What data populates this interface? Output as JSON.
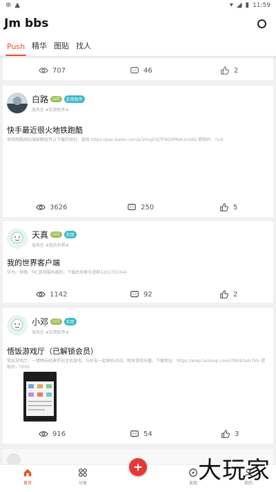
{
  "status_bar": {
    "time": "11:59",
    "left_icons": [
      "app-notification-icon",
      "a-letter-icon"
    ],
    "right_icons": [
      "wifi-icon",
      "signal-icon",
      "battery-icon"
    ]
  },
  "app": {
    "title": "Jm bbs",
    "accent_color": "#e4502a"
  },
  "tabs": [
    {
      "label": "Push",
      "active": true
    },
    {
      "label": "精华",
      "active": false
    },
    {
      "label": "图贴",
      "active": false
    },
    {
      "label": "找人",
      "active": false
    }
  ],
  "feed": {
    "partial_top": {
      "views": "707",
      "comments": "46",
      "likes": "2"
    },
    "posts": [
      {
        "user": "白路",
        "level": "LV2",
        "role": "实用软件",
        "sub": "发布在 #实用软件#",
        "title": "快手最近很火地铁跑酷",
        "body": "地铁跑酷国际服破解版可以下载的地址：链接 https://pan.baidu.com/s/1HvgDSJTFNDSPRNLm3dQ 提取码：7uiil",
        "views": "3626",
        "comments": "250",
        "likes": "5"
      },
      {
        "user": "天真",
        "level": "LV2",
        "role": "实用",
        "sub": "发布在 #我的世界#",
        "title": "我的世界客户端",
        "body": "华为、奔腾、MC游戏服务器的，下载后有群号进群1201703344",
        "views": "1142",
        "comments": "92",
        "likes": "2"
      },
      {
        "user": "小邓",
        "level": "LV2",
        "role": "实用",
        "sub": "发布在 #实用软件#",
        "title": "悟饭游戏厅（已解锁会员）",
        "body": "悟饭游戏厅，一键畅玩经典怀旧主机游戏，与好友一起联机对战，畅享游戏乐趣。下载地址：https://wwp.lanzoup.com/i7BUk0aln7Mv 提取码：hhhh",
        "views": "916",
        "comments": "54",
        "likes": "3"
      }
    ]
  },
  "bottom_nav": {
    "items": [
      {
        "label": "首页",
        "active": true
      },
      {
        "label": "分类",
        "active": false
      },
      {
        "label": "发现",
        "active": false
      },
      {
        "label": "我的",
        "active": false
      }
    ]
  },
  "watermark": "大玩家"
}
